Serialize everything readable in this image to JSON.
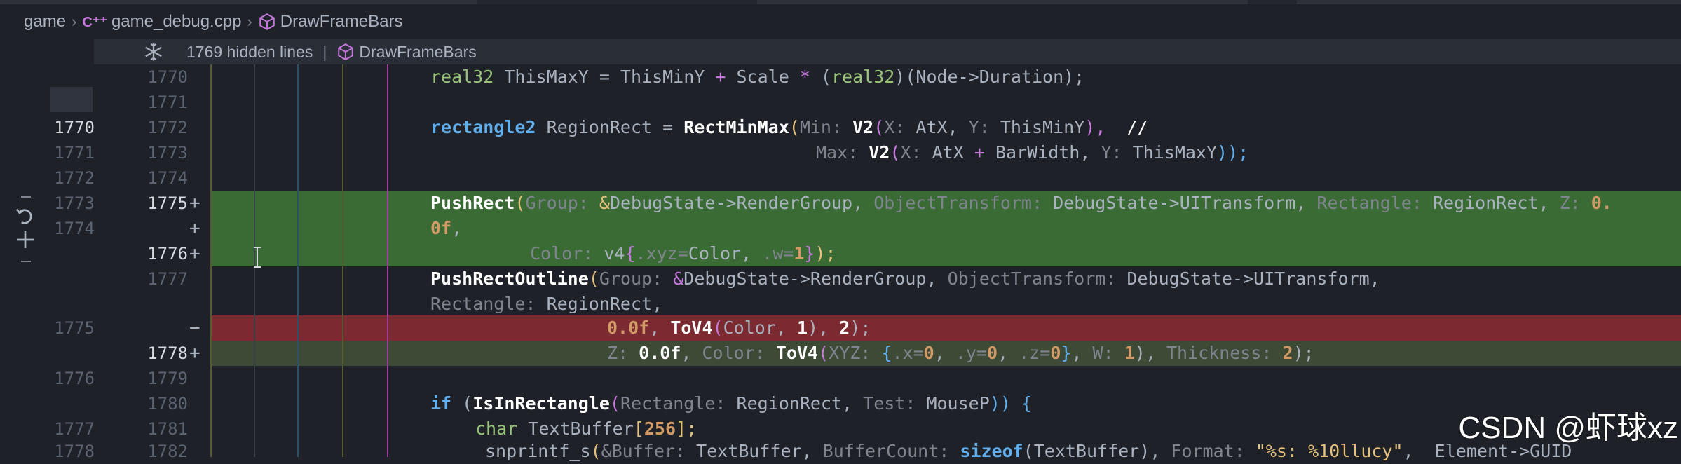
{
  "breadcrumb": {
    "folder": "game",
    "file": "game_debug.cpp",
    "file_icon": "cpp-icon",
    "symbol": "DrawFrameBars",
    "symbol_icon": "cube-icon"
  },
  "hidden_bar": {
    "label": "1769 hidden lines",
    "symbol": "DrawFrameBars"
  },
  "rows": [
    {
      "left": "",
      "right": "1770",
      "mark": ""
    },
    {
      "left": "",
      "right": "1771",
      "mark": ""
    },
    {
      "left": "1770",
      "right": "1772",
      "mark": ""
    },
    {
      "left": "1771",
      "right": "1773",
      "mark": ""
    },
    {
      "left": "1772",
      "right": "1774",
      "mark": ""
    },
    {
      "left": "1773",
      "right": "1775",
      "mark": "+"
    },
    {
      "left": "1774",
      "right": "",
      "mark": "+"
    },
    {
      "left": "",
      "right": "1776",
      "mark": "+"
    },
    {
      "left": "",
      "right": "1777",
      "mark": ""
    },
    {
      "left": "",
      "right": "",
      "mark": ""
    },
    {
      "left": "1775",
      "right": "",
      "mark": "−"
    },
    {
      "left": "",
      "right": "1778",
      "mark": "+"
    },
    {
      "left": "1776",
      "right": "1779",
      "mark": ""
    },
    {
      "left": "",
      "right": "1780",
      "mark": ""
    },
    {
      "left": "1777",
      "right": "1781",
      "mark": ""
    },
    {
      "left": "1778",
      "right": "1782",
      "mark": ""
    }
  ],
  "code": {
    "l0": {
      "a": "real32",
      "b": " ThisMaxY = ThisMinY ",
      "c": "+",
      "d": " Scale ",
      "e": "*",
      "f": " (",
      "g": "real32",
      "h": ")(Node->Duration);"
    },
    "l2": {
      "a": "rectangle2",
      "b": " RegionRect = ",
      "c": "RectMinMax",
      "d": "(",
      "e": "Min:",
      "f": " ",
      "g": "V2",
      "h": "(",
      "i": "X:",
      "j": " AtX, ",
      "k": "Y:",
      "l": " ThisMinY",
      "m": "),",
      "n": "  //"
    },
    "l3": {
      "a": "Max:",
      "b": " ",
      "c": "V2",
      "d": "(",
      "e": "X:",
      "f": " AtX ",
      "g": "+",
      "h": " BarWidth, ",
      "i": "Y:",
      "j": " ThisMaxY",
      "k": "));"
    },
    "l5": {
      "a": "PushRect",
      "b": "(",
      "c": "Group:",
      "d": " ",
      "e": "&",
      "f": "DebugState->RenderGroup, ",
      "g": "ObjectTransform:",
      "h": " DebugState->UITransform, ",
      "i": "Rectangle:",
      "j": " RegionRect, ",
      "k": "Z:",
      "l": " 0."
    },
    "l6": {
      "a": "0f",
      "b": ","
    },
    "l7": {
      "a": "Color:",
      "b": " v4",
      "c": "{",
      "d": ".xyz=",
      "e": "Color, ",
      "f": ".w=",
      "g": "1",
      "h": "}",
      "i": ");"
    },
    "l8": {
      "a": "PushRectOutline",
      "b": "(",
      "c": "Group:",
      "d": " ",
      "e": "&",
      "f": "DebugState->RenderGroup, ",
      "g": "ObjectTransform:",
      "h": " DebugState->UITransform,"
    },
    "l9": {
      "a": "Rectangle:",
      "b": " RegionRect,"
    },
    "l10": {
      "a": "0.0f",
      "b": ", ",
      "c": "ToV4",
      "d": "(",
      "e": "Color",
      "f": ", ",
      "g": "1",
      "h": "), ",
      "i": "2",
      "j": ");"
    },
    "l11": {
      "a": "Z:",
      "b": " ",
      "c": "0.0f",
      "d": ", ",
      "e": "Color:",
      "f": " ",
      "g": "ToV4",
      "h": "(",
      "i": "XYZ:",
      "j": " ",
      "k": "{",
      "l": ".x=",
      "m": "0",
      "n": ", ",
      "o": ".y=",
      "p": "0",
      "q": ", ",
      "r": ".z=",
      "s": "0",
      "t": "}",
      "u": ", ",
      "v": "W:",
      "w": " ",
      "x": "1",
      "y": "), ",
      "z": "Thickness:",
      "aa": " ",
      "ab": "2",
      "ac": ");"
    },
    "l13": {
      "a": "if",
      "b": " (",
      "c": "IsInRectangle",
      "d": "(",
      "e": "Rectangle:",
      "f": " RegionRect, ",
      "g": "Test:",
      "h": " MouseP",
      "i": ")) {"
    },
    "l14": {
      "a": "char",
      "b": " TextBuffer",
      "c": "[",
      "d": "256",
      "e": "];"
    },
    "l15": {
      "a": "snprintf_s",
      "b": "(",
      "c": "&Buffer:",
      "d": " TextBuffer, ",
      "e": "BufferCount:",
      "f": " ",
      "g": "sizeof",
      "h": "(TextBuffer), ",
      "i": "Format:",
      "j": " ",
      "k": "\"%s: %10llucy\"",
      "l": ",  Element->GUID"
    }
  },
  "watermark": "CSDN @虾球xz",
  "colors": {
    "added": "#3a6b35",
    "removed": "#7a2a30",
    "modified": "#3d4a36",
    "background": "#1e2228"
  }
}
